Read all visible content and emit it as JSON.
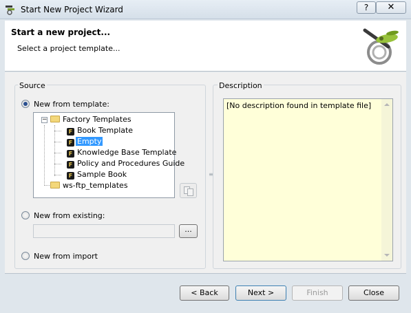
{
  "window": {
    "title": "Start New Project Wizard",
    "help_label": "?",
    "close_label": "✕"
  },
  "header": {
    "title": "Start a new project...",
    "subtitle": "Select a project template..."
  },
  "source": {
    "label": "Source",
    "from_template_label": "New from template:",
    "from_existing_label": "New from existing:",
    "from_import_label": "New from import",
    "selected": "template"
  },
  "tree": {
    "expander": "−",
    "factory": "Factory Templates",
    "items": [
      "Book Template",
      "Empty",
      "Knowledge Base Template",
      "Policy and Procedures Guide",
      "Sample Book"
    ],
    "selected_item": "Empty",
    "wsftp": "ws-ftp_templates"
  },
  "existing": {
    "value": "",
    "browse_label": "..."
  },
  "description": {
    "label": "Description",
    "text": "[No description found in template file]"
  },
  "buttons": {
    "back": "< Back",
    "next": "Next >",
    "finish": "Finish",
    "close": "Close"
  },
  "icons": {
    "app": "wizard-app-icon",
    "logo": "wizard-plane-icon",
    "folder": "folder-icon",
    "template": "template-icon",
    "copy": "copy-template-icon"
  },
  "colors": {
    "selection": "#3399ff",
    "description_bg": "#ffffd9",
    "header_bg": "#ffffff"
  }
}
